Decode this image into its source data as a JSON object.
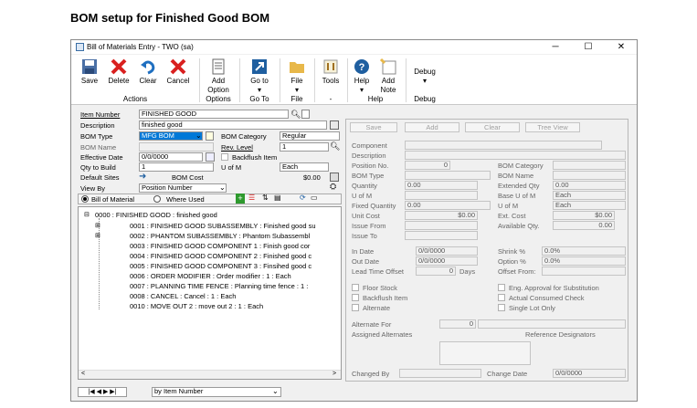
{
  "caption": "BOM setup for Finished Good BOM",
  "window": {
    "title": "Bill of Materials Entry  -  TWO (sa)"
  },
  "ribbon": {
    "buttons": [
      {
        "label": "Save",
        "icon": "save-icon"
      },
      {
        "label": "Delete",
        "icon": "delete-x-icon"
      },
      {
        "label": "Clear",
        "icon": "clear-undo-icon"
      },
      {
        "label": "Cancel",
        "icon": "cancel-x-icon"
      },
      {
        "label": "Add",
        "label2": "Option",
        "icon": "add-option-icon"
      },
      {
        "label": "Go to",
        "icon": "goto-arrow-icon"
      },
      {
        "label": "File",
        "icon": "file-folder-icon"
      },
      {
        "label": "Tools",
        "icon": "tools-icon"
      },
      {
        "label": "Help",
        "icon": "help-question-icon"
      },
      {
        "label": "Add",
        "label2": "Note",
        "icon": "add-note-icon"
      },
      {
        "label": "Debug",
        "icon": "debug-icon"
      }
    ],
    "groups": {
      "actions": "Actions",
      "options": "Options",
      "goto": "Go To",
      "file": "File",
      "tools": "-",
      "help": "Help",
      "debug": "Debug"
    }
  },
  "form": {
    "item_number_label": "Item Number",
    "item_number": "FINISHED GOOD",
    "description_label": "Description",
    "description": "finished good",
    "bom_type_label": "BOM Type",
    "bom_type": "MFG BOM",
    "bom_category_label": "BOM Category",
    "bom_category": "Regular",
    "bom_name_label": "BOM Name",
    "rev_level_label": "Rev. Level",
    "rev_level": "1",
    "effective_date_label": "Effective Date",
    "effective_date": "0/0/0000",
    "backflush_label": "Backflush Item",
    "qty_to_build_label": "Qty to Build",
    "qty_to_build": "1",
    "uofm_label": "U of M",
    "uofm": "Each",
    "default_sites_label": "Default Sites",
    "bom_cost_label": "BOM Cost",
    "bom_cost": "$0.00",
    "view_by_label": "View By",
    "view_by": "Position Number",
    "radio_bom": "Bill of Material",
    "radio_where_used": "Where Used"
  },
  "tree": {
    "root": "0000 : FINISHED GOOD  :  finished good",
    "children": [
      "0001 : FINISHED GOOD SUBASSEMBLY  :  Finished good su",
      "0002 : PHANTOM SUBASSEMBLY  :  Phantom Subassembl",
      "0003 : FINISHED GOOD COMPONENT 1  :  Finish good cor",
      "0004 : FINISHED GOOD COMPONENT 2  :  Finished good c",
      "0005 : FINISHED GOOD COMPONENT 3  :  Finsihed good c",
      "0006 : ORDER MODIFIER  :  Order modifier : 1 : Each",
      "0007 : PLANNING TIME FENCE  :  Planning time fence : 1 :",
      "0008 : CANCEL  :  Cancel : 1 : Each",
      "0010 : MOVE OUT 2  :  move out 2 : 1 : Each"
    ]
  },
  "right": {
    "buttons": [
      "Save",
      "Add",
      "Clear",
      "Tree View"
    ],
    "component": "Component",
    "description": "Description",
    "position_no": "Position No.",
    "position_value": "0",
    "bom_type": "BOM Type",
    "quantity": "Quantity",
    "quantity_value": "0.00",
    "uofm": "U of M",
    "fixed_quantity": "Fixed Quantity",
    "fixed_quantity_value": "0.00",
    "unit_cost": "Unit Cost",
    "unit_cost_value": "$0.00",
    "issue_from": "Issue From",
    "issue_to": "Issue To",
    "bom_category": "BOM Category",
    "bom_name": "BOM Name",
    "extended_qty": "Extended Qty",
    "extended_qty_value": "0.00",
    "base_uofm": "Base U of M",
    "base_uofm_value": "Each",
    "r_uofm": "U of M",
    "r_uofm_value": "Each",
    "ext_cost": "Ext. Cost",
    "ext_cost_value": "$0.00",
    "available_qty": "Available Qty.",
    "available_qty_value": "0.00",
    "in_date": "In Date",
    "in_date_value": "0/0/0000",
    "out_date": "Out Date",
    "out_date_value": "0/0/0000",
    "lead_time": "Lead Time Offset",
    "lead_time_value": "0",
    "days": "Days",
    "shrink": "Shrink %",
    "shrink_value": "0.0%",
    "option": "Option %",
    "option_value": "0.0%",
    "offset_from": "Offset From:",
    "floor_stock": "Floor Stock",
    "backflush_item": "Backflush Item",
    "alternate": "Alternate",
    "eng_approval": "Eng. Approval for Substitution",
    "actual_consumed": "Actual Consumed Check",
    "single_lot": "Single Lot Only",
    "alternate_for": "Alternate For",
    "alternate_for_value": "0",
    "assigned_alternates": "Assigned Alternates",
    "reference_designators": "Reference Designators",
    "changed_by": "Changed By",
    "change_date": "Change Date",
    "change_date_value": "0/0/0000"
  },
  "status": {
    "nav": "|◀  ◀  ▶  ▶|",
    "sort": "by Item Number"
  },
  "colors": {
    "accent": "#3a6ea5",
    "highlight": "#0078d7",
    "red": "#d9201f"
  }
}
